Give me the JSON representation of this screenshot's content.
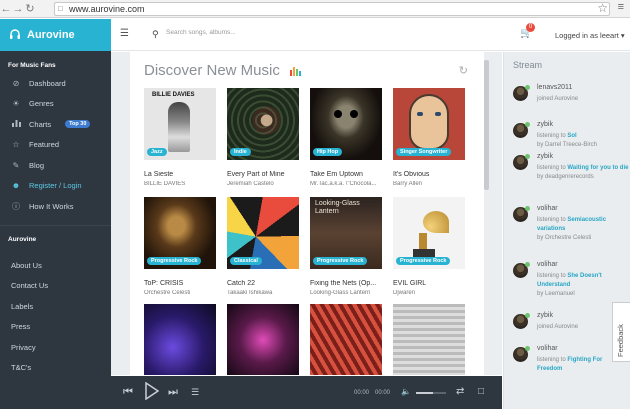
{
  "browser": {
    "url": "www.aurovine.com"
  },
  "brand": {
    "name": "Aurovine"
  },
  "sidebar": {
    "section1_title": "For Music Fans",
    "items": [
      {
        "label": "Dashboard",
        "icon": "dashboard-icon"
      },
      {
        "label": "Genres",
        "icon": "genres-icon"
      },
      {
        "label": "Charts",
        "icon": "charts-icon",
        "pill": "Top 30"
      },
      {
        "label": "Featured",
        "icon": "star-icon"
      },
      {
        "label": "Blog",
        "icon": "blog-icon"
      },
      {
        "label": "Register / Login",
        "icon": "user-icon"
      },
      {
        "label": "How It Works",
        "icon": "info-icon"
      }
    ],
    "section2_title": "Aurovine",
    "links": [
      "About Us",
      "Contact Us",
      "Labels",
      "Press",
      "Privacy",
      "T&C's"
    ]
  },
  "topbar": {
    "search_placeholder": "Search songs, albums...",
    "cart_count": "0",
    "logged_in": "Logged in as leeart ▾"
  },
  "main": {
    "title": "Discover New Music",
    "tiles": [
      {
        "title": "La Sieste",
        "artist": "BILLIE DAVIES",
        "genre": "Jazz",
        "art_label": "BILLIE DAVIES"
      },
      {
        "title": "Every Part of Mine",
        "artist": "Jeremiah Castelo",
        "genre": "Indie"
      },
      {
        "title": "Take Em Uptown",
        "artist": "Mr.Tac.a.k.a. \\\"Chocola...",
        "genre": "Hip Hop"
      },
      {
        "title": "It's Obvious",
        "artist": "Barry Allen",
        "genre": "Singer Songwriter"
      },
      {
        "title": "ToP: CRISIS",
        "artist": "Orchestre Celesti",
        "genre": "Progressive Rock"
      },
      {
        "title": "Catch 22",
        "artist": "Takaaki Ishikawa",
        "genre": "Classical"
      },
      {
        "title": "Fixing the Nets (Op...",
        "artist": "Looking-Glass Lantern",
        "genre": "Progressive Rock",
        "art_label": "Looking-Glass Lantern"
      },
      {
        "title": "EVIL GIRL",
        "artist": "Djwaren",
        "genre": "Progressive Rock"
      },
      {
        "title": "",
        "artist": "",
        "genre": ""
      },
      {
        "title": "",
        "artist": "",
        "genre": ""
      },
      {
        "title": "",
        "artist": "",
        "genre": ""
      },
      {
        "title": "",
        "artist": "",
        "genre": ""
      }
    ]
  },
  "player": {
    "time_current": "00:00",
    "time_total": "00:00",
    "volume": 0.55
  },
  "stream": {
    "title": "Stream",
    "items": [
      {
        "user": "lenavs2011",
        "pre": "joined Aurovine",
        "track": "",
        "by": ""
      },
      {
        "user": "zybik",
        "pre": "listening to",
        "track": "Sol",
        "by": "by Darrel Treece-Birch"
      },
      {
        "user": "zybik",
        "pre": "listening to",
        "track": "Waiting for you to die",
        "by": "by deadgenrerecords"
      },
      {
        "user": "volihar",
        "pre": "listening to",
        "track": "Semiacoustic variations",
        "by": "by Orchestre Celesti"
      },
      {
        "user": "volihar",
        "pre": "listening to",
        "track": "She Doesn't Understand",
        "by": "by Leemanuel"
      },
      {
        "user": "zybik",
        "pre": "joined Aurovine",
        "track": "",
        "by": ""
      },
      {
        "user": "volihar",
        "pre": "listening to",
        "track": "Fighting For Freedom",
        "by": ""
      }
    ],
    "feedback": "Feedback"
  },
  "colors": {
    "accent": "#29b3d2",
    "sidebar": "#2e3740",
    "badge": "#e94b3c"
  }
}
